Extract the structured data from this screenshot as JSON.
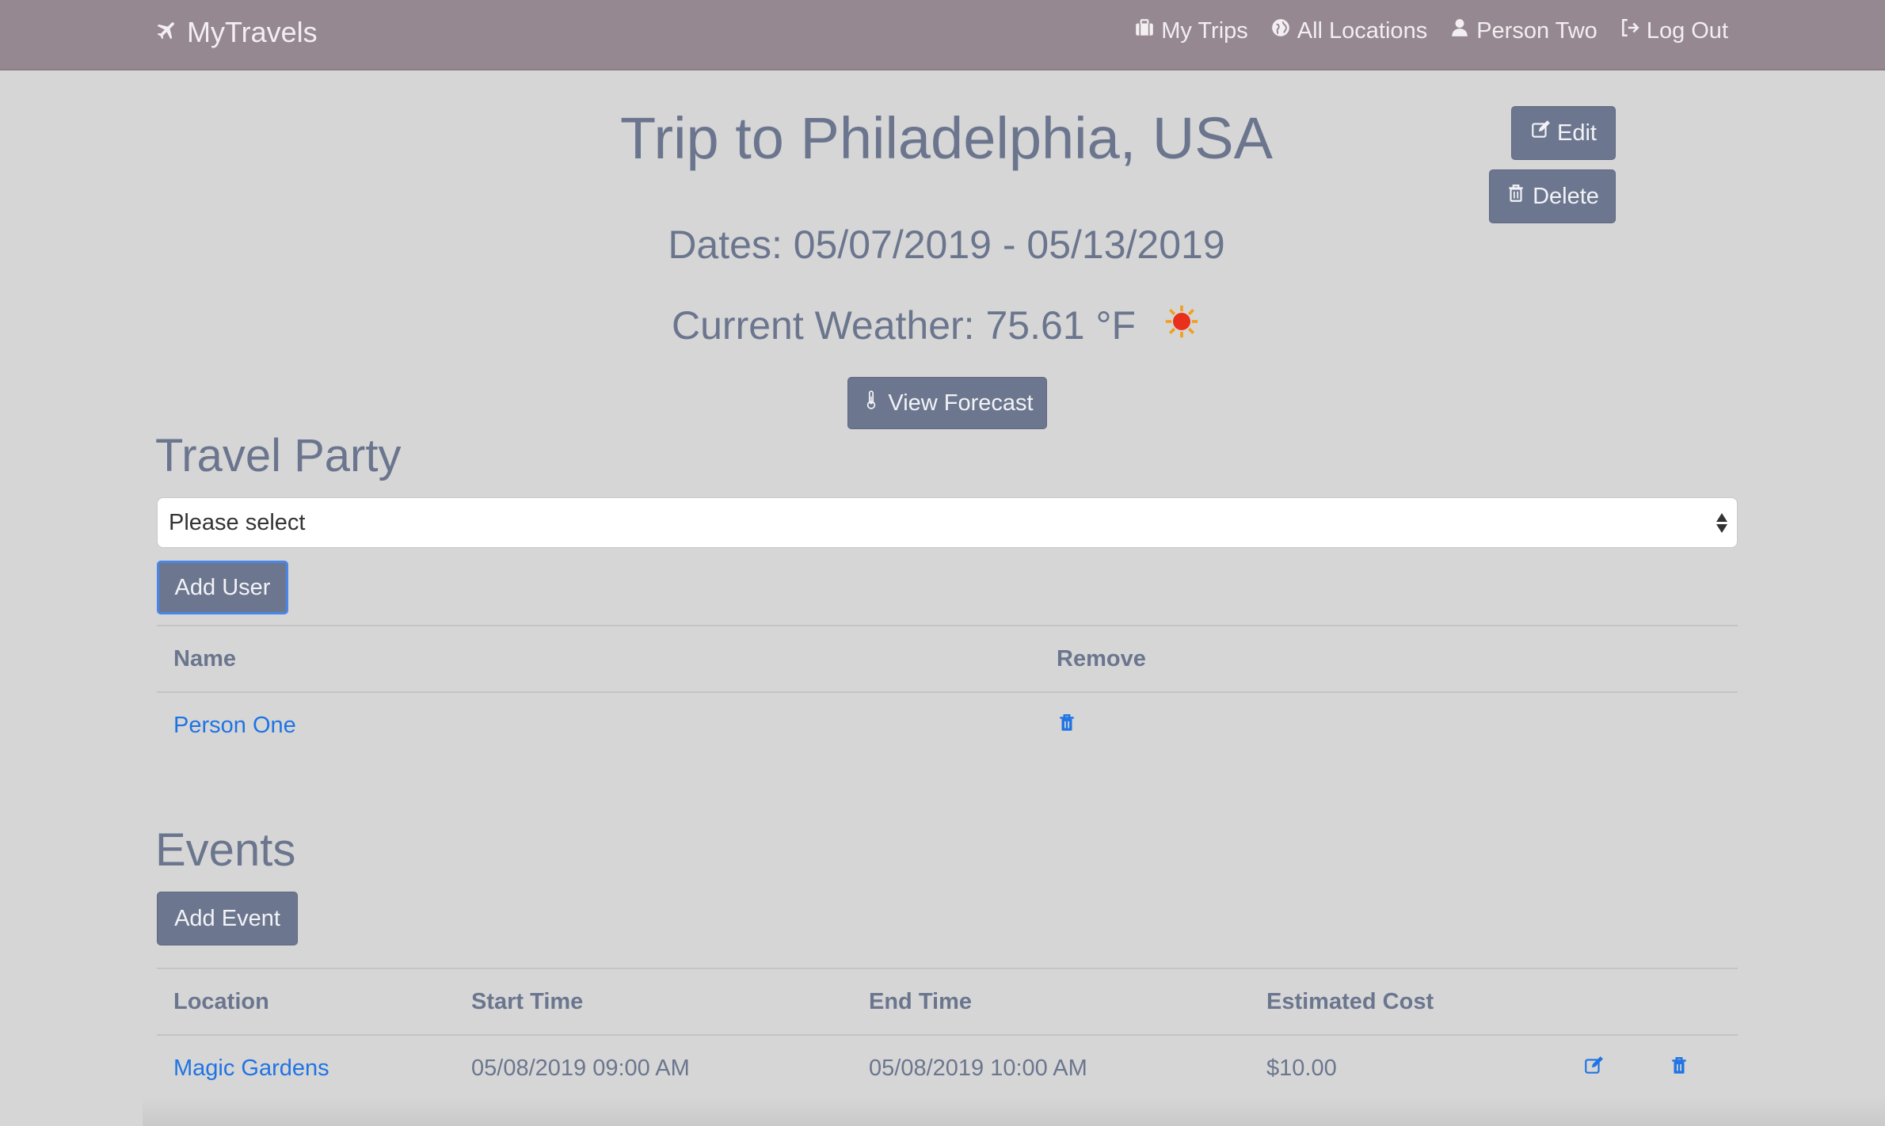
{
  "nav": {
    "brand": "MyTravels",
    "links": [
      {
        "label": "My Trips",
        "icon": "suitcase-icon"
      },
      {
        "label": "All Locations",
        "icon": "globe-icon"
      },
      {
        "label": "Person Two",
        "icon": "user-icon"
      },
      {
        "label": "Log Out",
        "icon": "sign-out-icon"
      }
    ]
  },
  "trip": {
    "title": "Trip to Philadelphia, USA",
    "dates": "Dates: 05/07/2019 - 05/13/2019",
    "weather": "Current Weather: 75.61 °F",
    "weather_icon": "sun-icon",
    "edit_label": "Edit",
    "delete_label": "Delete",
    "forecast_label": "View Forecast"
  },
  "travel_party": {
    "title": "Travel Party",
    "select_value": "Please select",
    "add_label": "Add User",
    "columns": [
      "Name",
      "Remove"
    ],
    "rows": [
      {
        "name": "Person One"
      }
    ]
  },
  "events": {
    "title": "Events",
    "add_label": "Add Event",
    "columns": [
      "Location",
      "Start Time",
      "End Time",
      "Estimated Cost"
    ],
    "rows": [
      {
        "location": "Magic Gardens",
        "start": "05/08/2019 09:00 AM",
        "end": "05/08/2019 10:00 AM",
        "cost": "$10.00"
      }
    ]
  },
  "colors": {
    "navbar": "#958890",
    "background": "#d6d6d6",
    "button": "#6c778f",
    "link": "#1f74e3",
    "text": "#6b768e"
  }
}
